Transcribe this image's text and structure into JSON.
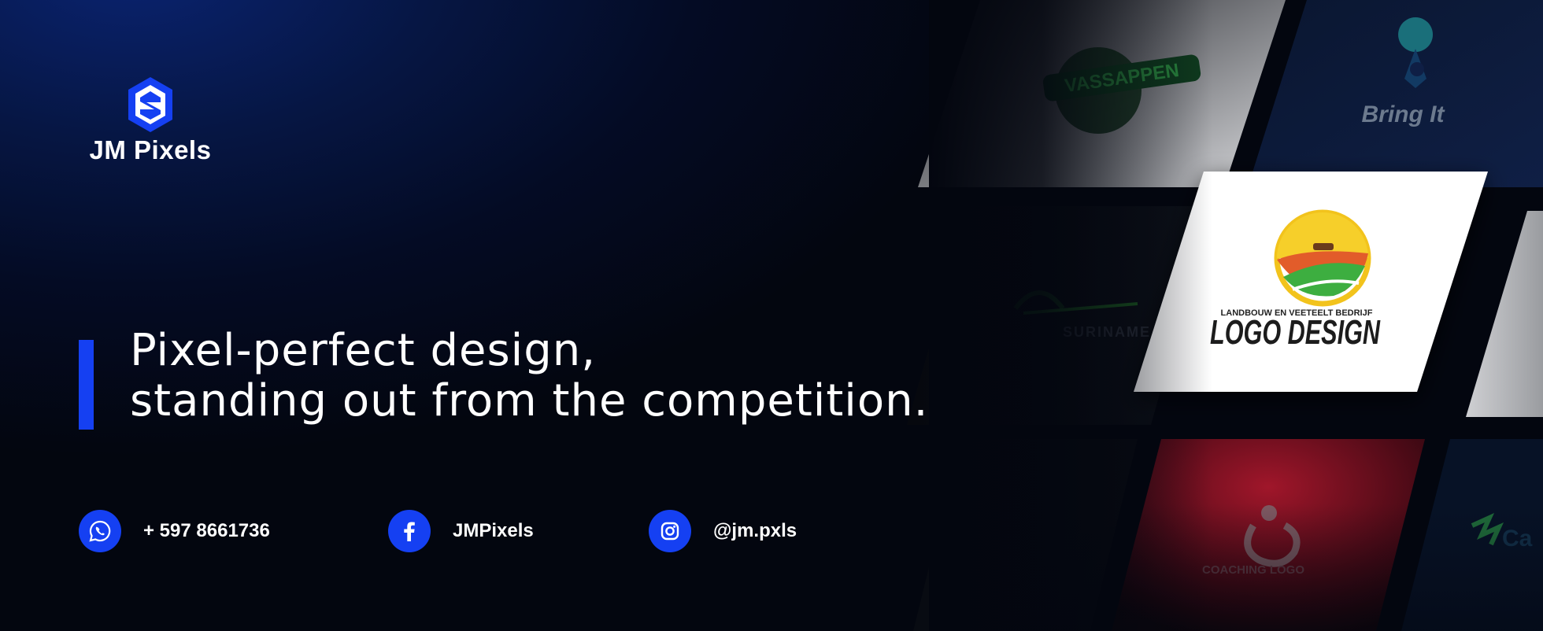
{
  "brand": {
    "name": "JM Pixels",
    "accent_color": "#1540f2"
  },
  "headline": {
    "line1": "Pixel-perfect design,",
    "line2": "standing out from the competition."
  },
  "contacts": [
    {
      "icon": "whatsapp-icon",
      "text": "+ 597 8661736"
    },
    {
      "icon": "facebook-icon",
      "text": "JMPixels"
    },
    {
      "icon": "instagram-icon",
      "text": "@jm.pxls"
    }
  ],
  "showcase": {
    "cards": [
      {
        "text": "VASSAPPEN"
      },
      {
        "text": "Bring It"
      },
      {
        "text": "LANDBOUW EN VEETEELT BEDRIJF",
        "title": "LOGO DESIGN"
      },
      {
        "text": "SURINAME"
      },
      {
        "text": "COACHING LOGO"
      },
      {
        "text": "Ca"
      }
    ]
  },
  "colors": {
    "background": "#03060f",
    "accent": "#1540f2",
    "text": "#ffffff"
  }
}
